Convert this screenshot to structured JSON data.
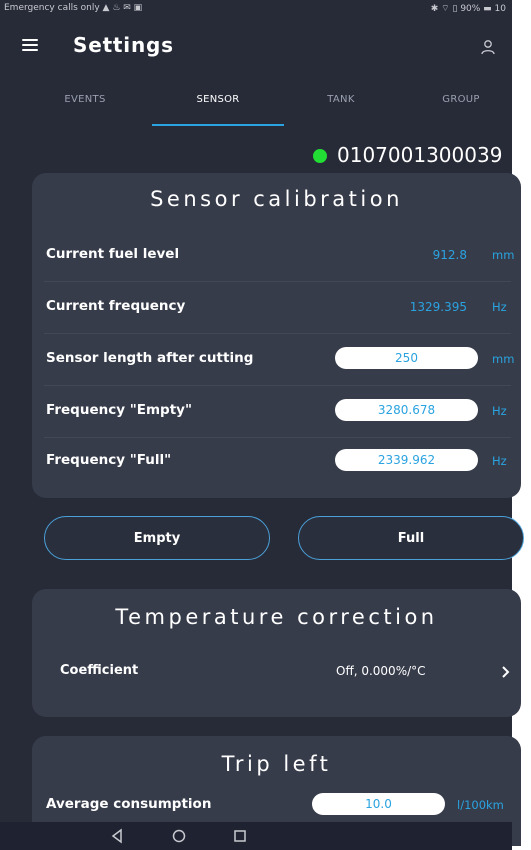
{
  "status_bar": {
    "left_text": "Emergency calls only ▲ ♨ ✉ ▣",
    "right_text": "✱ ⌔ ▯ 90% ▬ 10"
  },
  "app_bar": {
    "title": "Settings",
    "menu_icon": "menu-icon",
    "user_icon": "user-icon"
  },
  "tabs": [
    {
      "label": "EVENTS",
      "active": false
    },
    {
      "label": "SENSOR",
      "active": true
    },
    {
      "label": "TANK",
      "active": false
    },
    {
      "label": "GROUP",
      "active": false
    }
  ],
  "device": {
    "id": "0107001300039",
    "status_color": "#22dd33"
  },
  "sensor_calibration": {
    "title": "Sensor calibration",
    "rows": [
      {
        "label": "Current fuel level",
        "value": "912.8",
        "unit": "mm"
      },
      {
        "label": "Current frequency",
        "value": "1329.395",
        "unit": "Hz"
      },
      {
        "label": "Sensor length after cutting",
        "input": "250",
        "unit": "mm"
      },
      {
        "label": "Frequency \"Empty\"",
        "input": "3280.678",
        "unit": "Hz"
      },
      {
        "label": "Frequency \"Full\"",
        "input": "2339.962",
        "unit": "Hz"
      }
    ]
  },
  "buttons": {
    "empty": "Empty",
    "full": "Full"
  },
  "temperature_correction": {
    "title": "Temperature correction",
    "label": "Coefficient",
    "value": "Off, 0.000%/°C"
  },
  "trip_left": {
    "title": "Trip left",
    "label": "Average consumption",
    "input": "10.0",
    "unit": "l/100km"
  },
  "colors": {
    "background": "#272b38",
    "card": "#373c4b",
    "accent": "#2aa3e0",
    "status_green": "#22dd33"
  }
}
